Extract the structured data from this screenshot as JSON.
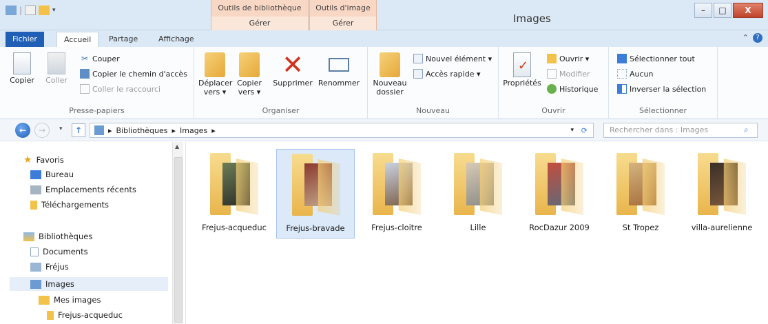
{
  "window": {
    "title": "Images",
    "ctx_tabs": [
      {
        "head": "Outils de bibliothèque",
        "sub": "Gérer"
      },
      {
        "head": "Outils d'image",
        "sub": "Gérer"
      }
    ],
    "minimize": "–",
    "maximize": "□",
    "close": "X"
  },
  "tabs": {
    "file": "Fichier",
    "home": "Accueil",
    "share": "Partage",
    "view": "Affichage"
  },
  "ribbon": {
    "clipboard": {
      "label": "Presse-papiers",
      "copy": "Copier",
      "paste": "Coller",
      "cut": "Couper",
      "copy_path": "Copier le chemin d'accès",
      "paste_shortcut": "Coller le raccourci"
    },
    "organize": {
      "label": "Organiser",
      "move_to": "Déplacer vers ▾",
      "copy_to": "Copier vers ▾",
      "delete": "Supprimer",
      "rename": "Renommer"
    },
    "new": {
      "label": "Nouveau",
      "new_folder": "Nouveau dossier",
      "new_item": "Nouvel élément ▾",
      "easy_access": "Accès rapide ▾"
    },
    "open": {
      "label": "Ouvrir",
      "properties": "Propriétés",
      "open": "Ouvrir ▾",
      "edit": "Modifier",
      "history": "Historique"
    },
    "select": {
      "label": "Sélectionner",
      "select_all": "Sélectionner tout",
      "select_none": "Aucun",
      "invert": "Inverser la sélection"
    }
  },
  "address": {
    "crumbs": [
      "Bibliothèques",
      "Images"
    ],
    "search_placeholder": "Rechercher dans : Images"
  },
  "navpane": {
    "favorites": "Favoris",
    "desktop": "Bureau",
    "recent": "Emplacements récents",
    "downloads": "Téléchargements",
    "libraries": "Bibliothèques",
    "documents": "Documents",
    "frejus": "Fréjus",
    "images": "Images",
    "my_images": "Mes images",
    "frejus_acqueduc": "Frejus-acqueduc"
  },
  "folders": [
    {
      "name": "Frejus-acqueduc",
      "selected": false
    },
    {
      "name": "Frejus-bravade",
      "selected": true
    },
    {
      "name": "Frejus-cloitre",
      "selected": false
    },
    {
      "name": "Lille",
      "selected": false
    },
    {
      "name": "RocDazur 2009",
      "selected": false
    },
    {
      "name": "St Tropez",
      "selected": false
    },
    {
      "name": "villa-aurelienne",
      "selected": false
    }
  ]
}
